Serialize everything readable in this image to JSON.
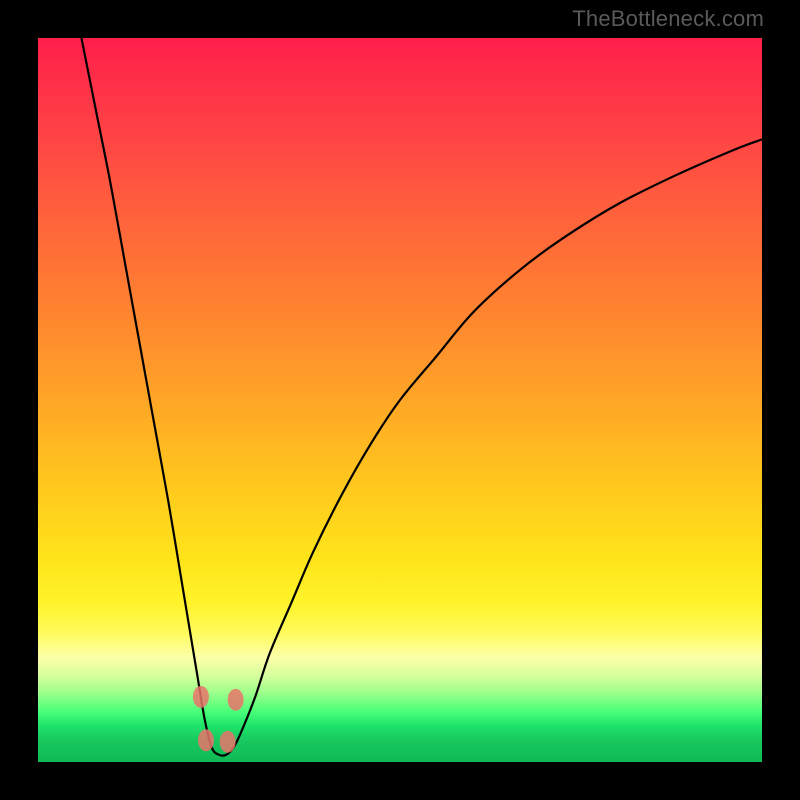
{
  "watermark": "TheBottleneck.com",
  "chart_data": {
    "type": "line",
    "title": "",
    "xlabel": "",
    "ylabel": "",
    "xlim": [
      0,
      100
    ],
    "ylim": [
      0,
      100
    ],
    "x": [
      6,
      8,
      10,
      12,
      14,
      16,
      18,
      20,
      21,
      22,
      23,
      24,
      25,
      26,
      27,
      28,
      30,
      32,
      35,
      38,
      42,
      46,
      50,
      55,
      60,
      66,
      72,
      80,
      88,
      96,
      100
    ],
    "values": [
      100,
      90,
      80,
      69,
      58,
      47,
      36,
      24,
      18,
      12,
      6,
      2,
      1,
      1,
      2,
      4,
      9,
      15,
      22,
      29,
      37,
      44,
      50,
      56,
      62,
      67.5,
      72,
      77,
      81,
      84.5,
      86
    ],
    "series": [
      {
        "name": "bottleneck-curve",
        "x": [
          6,
          8,
          10,
          12,
          14,
          16,
          18,
          20,
          21,
          22,
          23,
          24,
          25,
          26,
          27,
          28,
          30,
          32,
          35,
          38,
          42,
          46,
          50,
          55,
          60,
          66,
          72,
          80,
          88,
          96,
          100
        ],
        "y": [
          100,
          90,
          80,
          69,
          58,
          47,
          36,
          24,
          18,
          12,
          6,
          2,
          1,
          1,
          2,
          4,
          9,
          15,
          22,
          29,
          37,
          44,
          50,
          56,
          62,
          67.5,
          72,
          77,
          81,
          84.5,
          86
        ]
      }
    ],
    "markers": [
      {
        "x": 22.5,
        "y": 9
      },
      {
        "x": 23.2,
        "y": 3
      },
      {
        "x": 26.2,
        "y": 2.8
      },
      {
        "x": 27.3,
        "y": 8.6
      }
    ],
    "background_gradient": {
      "top": "#ff1f4a",
      "mid": "#ffe41a",
      "bottom": "#0fb955"
    }
  }
}
